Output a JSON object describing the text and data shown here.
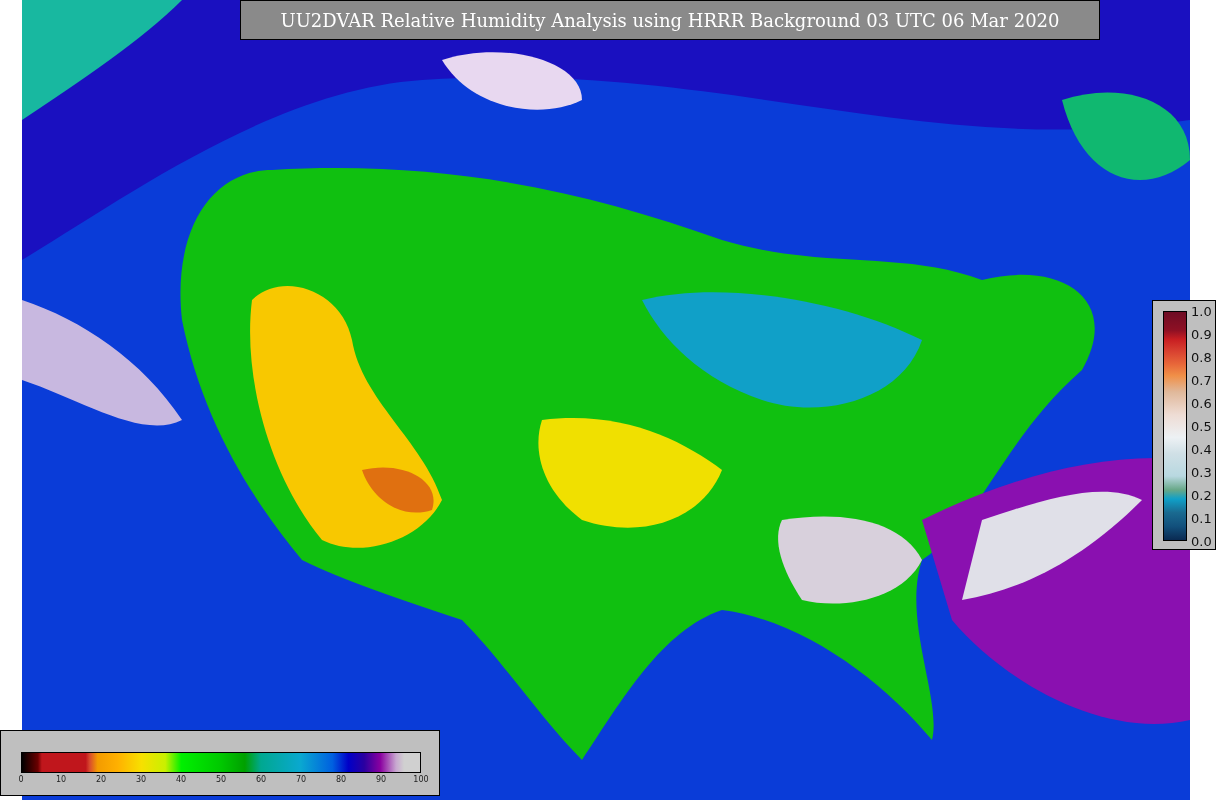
{
  "title": "UU2DVAR Relative Humidity Analysis using HRRR Background 03 UTC 06 Mar 2020",
  "humidity_colorbar": {
    "ticks": [
      "0",
      "10",
      "20",
      "30",
      "40",
      "50",
      "60",
      "70",
      "80",
      "90",
      "100"
    ]
  },
  "station_colorbar": {
    "ticks": [
      "1.0",
      "0.9",
      "0.8",
      "0.7",
      "0.6",
      "0.5",
      "0.4",
      "0.3",
      "0.2",
      "0.1",
      "0.0"
    ]
  }
}
